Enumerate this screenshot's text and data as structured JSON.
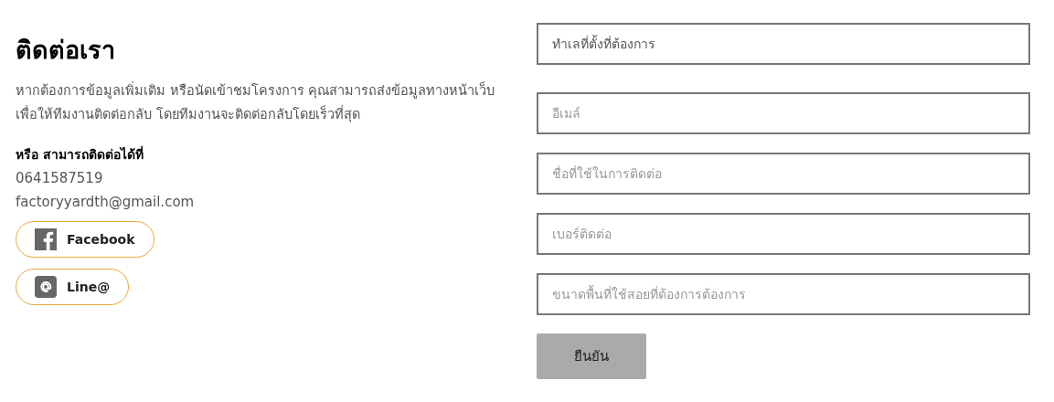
{
  "contact": {
    "title": "ติดต่อเรา",
    "description": "หากต้องการข้อมูลเพิ่มเติม หรือนัดเข้าชมโครงการ คุณสามารถส่งข้อมูลทางหน้าเว็บเพื่อให้ทีมงานติดต่อกลับ โดยทีมงานจะติดต่อกลับโดยเร็วที่สุด",
    "alt_heading": "หรือ สามารถติดต่อได้ที่",
    "phone": "0641587519",
    "email": "factoryyardth@gmail.com",
    "social": [
      {
        "kind": "facebook",
        "label": "Facebook"
      },
      {
        "kind": "line",
        "label": "Line@"
      }
    ]
  },
  "form": {
    "fields": [
      {
        "kind": "select",
        "placeholder": "ทำเลที่ตั้งที่ต้องการ"
      },
      {
        "kind": "text",
        "placeholder": "อีเมล์"
      },
      {
        "kind": "text",
        "placeholder": "ชื่อที่ใช้ในการติดต่อ"
      },
      {
        "kind": "text",
        "placeholder": "เบอร์ติดต่อ"
      },
      {
        "kind": "text",
        "placeholder": "ขนาดพื้นที่ใช้สอยที่ต้องการต้องการ"
      }
    ],
    "submit": "ยืนยัน"
  }
}
